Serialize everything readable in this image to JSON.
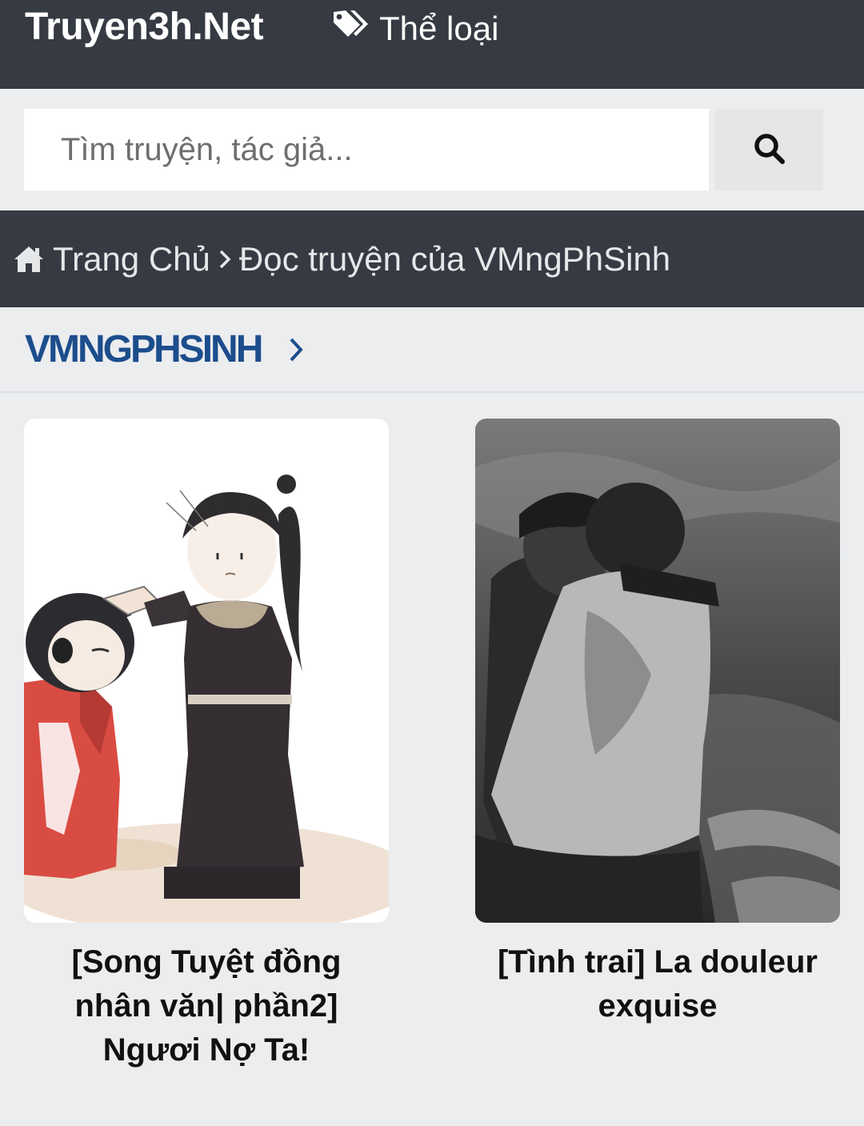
{
  "header": {
    "logo": "Truyen3h.Net",
    "genre_label": "Thể loại",
    "genre_icon": "tags-icon"
  },
  "search": {
    "placeholder": "Tìm truyện, tác giả...",
    "button_icon": "search-icon"
  },
  "breadcrumb": {
    "home_icon": "home-icon",
    "home_label": "Trang Chủ",
    "current": "Đọc truyện của VMngPhSinh"
  },
  "author": {
    "name": "VMngPhSinh"
  },
  "stories": [
    {
      "title": "[Song Tuyệt đồng nhân văn| phần2] Ngươi Nợ Ta!",
      "cover": "chibi illustration: dark-robed figure with long black ponytail patting the head of a red-robed figure"
    },
    {
      "title": "[Tình trai] La douleur exquise",
      "cover": "grayscale painting of two figures embracing against a stormy sea"
    }
  ],
  "colors": {
    "header_bg": "#363a42",
    "page_bg": "#ebedef",
    "author_accent": "#1c4d8c"
  }
}
